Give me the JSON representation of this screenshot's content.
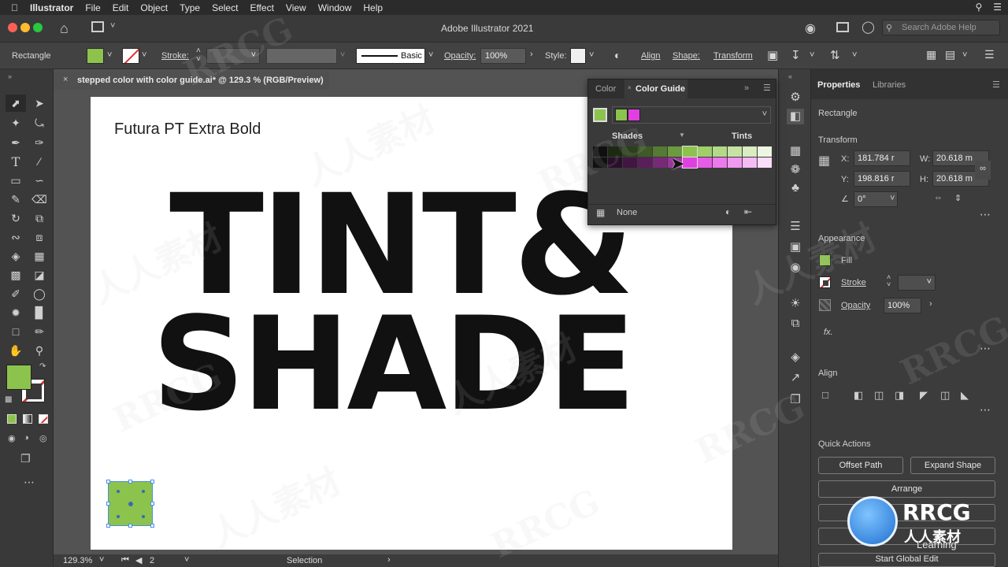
{
  "menubar": {
    "app": "Illustrator",
    "items": [
      "File",
      "Edit",
      "Object",
      "Type",
      "Select",
      "Effect",
      "View",
      "Window",
      "Help"
    ]
  },
  "appbar": {
    "title": "Adobe Illustrator 2021",
    "search_placeholder": "Search Adobe Help"
  },
  "control": {
    "object": "Rectangle",
    "stroke_label": "Stroke:",
    "brush": "Basic",
    "opacity_label": "Opacity:",
    "opacity": "100%",
    "style_label": "Style:",
    "align": "Align",
    "shape": "Shape:",
    "transform": "Transform"
  },
  "document": {
    "tab": "stepped color with color guide.ai* @ 129.3 % (RGB/Preview)",
    "font_label": "Futura PT Extra Bold",
    "line1": "TINT&",
    "line2": "SHADE"
  },
  "status": {
    "zoom": "129.3%",
    "artboard": "2",
    "tool": "Selection"
  },
  "color_guide": {
    "tab_color": "Color",
    "tab_guide": "Color Guide",
    "shades": "Shades",
    "tints": "Tints",
    "none": "None",
    "base_green": "#8cc34d",
    "base_magenta": "#e040e0",
    "row1": [
      "#101010",
      "#1c2a12",
      "#2c401c",
      "#3f5a26",
      "#557a33",
      "#6c9a3e",
      "#8cc34d",
      "#a0cf6a",
      "#b4d987",
      "#c6e3a3",
      "#d9ecc2",
      "#ecf6e1"
    ],
    "row2": [
      "#101010",
      "#2a0f2a",
      "#411641",
      "#5a1e5a",
      "#782a78",
      "#9a359a",
      "#e040e0",
      "#e65ce6",
      "#ec7aec",
      "#f199f1",
      "#f6bbf6",
      "#fbddfb"
    ]
  },
  "properties": {
    "tab1": "Properties",
    "tab2": "Libraries",
    "object": "Rectangle",
    "transform": "Transform",
    "x": "181.784 r",
    "y": "198.816 r",
    "w": "20.618 m",
    "h": "20.618 m",
    "angle": "0°",
    "appearance": "Appearance",
    "fill": "Fill",
    "stroke": "Stroke",
    "opacity_label": "Opacity",
    "opacity": "100%",
    "fx": "fx.",
    "align": "Align",
    "quick_actions": "Quick Actions",
    "offset_path": "Offset Path",
    "expand_shape": "Expand Shape",
    "arrange": "Arrange",
    "start_global_edit": "Start Global Edit"
  },
  "watermark": {
    "rrcg": "RRCG",
    "cn": "人人素材",
    "learning": "Learning"
  },
  "colors": {
    "fill_green": "#8cc34d"
  }
}
